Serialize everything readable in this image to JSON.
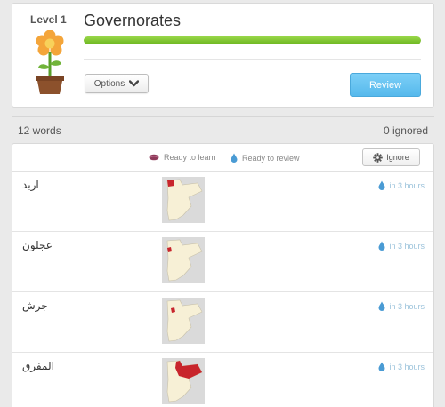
{
  "level": {
    "label": "Level 1",
    "title": "Governorates",
    "progress": 1.0,
    "options_label": "Options",
    "review_label": "Review"
  },
  "summary": {
    "words": "12 words",
    "ignored": "0 ignored"
  },
  "legend": {
    "learn": "Ready to learn",
    "review": "Ready to review",
    "ignore_label": "Ignore"
  },
  "words": [
    {
      "text": "اربد",
      "due": "in 3 hours",
      "highlight": "north"
    },
    {
      "text": "عجلون",
      "due": "in 3 hours",
      "highlight": "northwest"
    },
    {
      "text": "جرش",
      "due": "in 3 hours",
      "highlight": "central-north"
    },
    {
      "text": "المفرق",
      "due": "in 3 hours",
      "highlight": "northeast"
    }
  ],
  "colors": {
    "accent_blue": "#56b9ec",
    "progress_green": "#7cc532",
    "map_highlight": "#c8252c",
    "water_drop": "#4a9bd4",
    "learn_icon": "#8e3a5a"
  },
  "icons": {
    "dropdown": "chevron-down-icon",
    "ignore": "gear-icon",
    "learn": "seed-icon",
    "review": "water-drop-icon",
    "due": "water-drop-icon"
  }
}
